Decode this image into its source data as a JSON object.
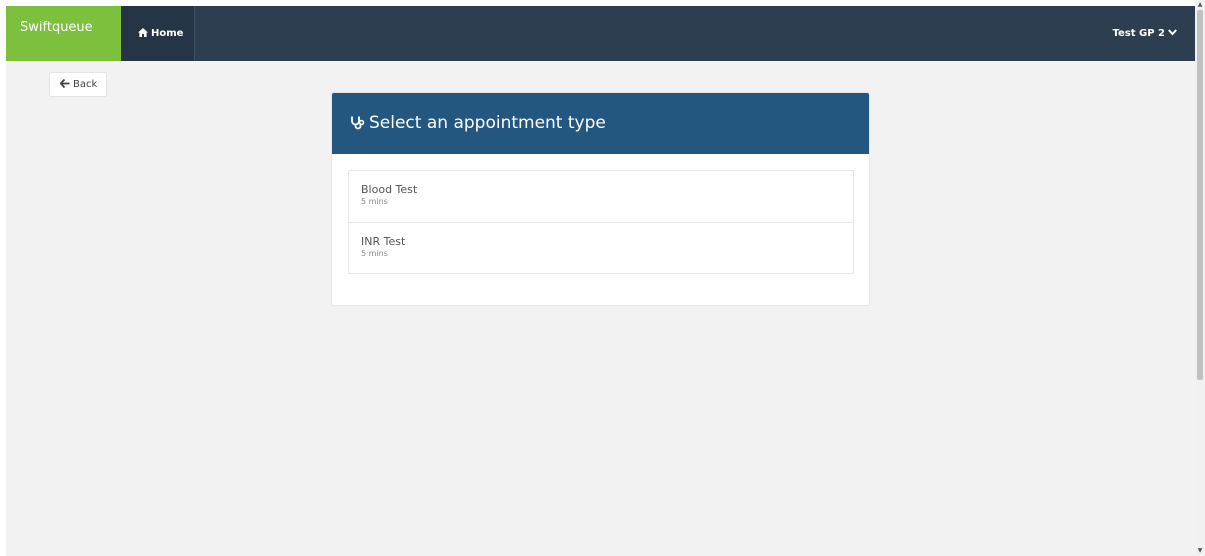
{
  "navbar": {
    "brand": "Swiftqueue",
    "home_label": "Home",
    "home_icon": "home-icon",
    "user_label": "Test GP 2",
    "user_icon": "chevron-down-icon",
    "colors": {
      "navbar_bg": "#2c3e50",
      "brand_bg": "#7cc03e",
      "home_bg": "#263545"
    }
  },
  "back_button": {
    "label": "Back",
    "icon": "arrow-left-icon"
  },
  "panel": {
    "title": "Select an appointment type",
    "icon": "stethoscope-icon",
    "header_color": "#245780",
    "items": [
      {
        "name": "Blood Test",
        "duration": "5 mins"
      },
      {
        "name": "INR Test",
        "duration": "5 mins"
      }
    ]
  }
}
